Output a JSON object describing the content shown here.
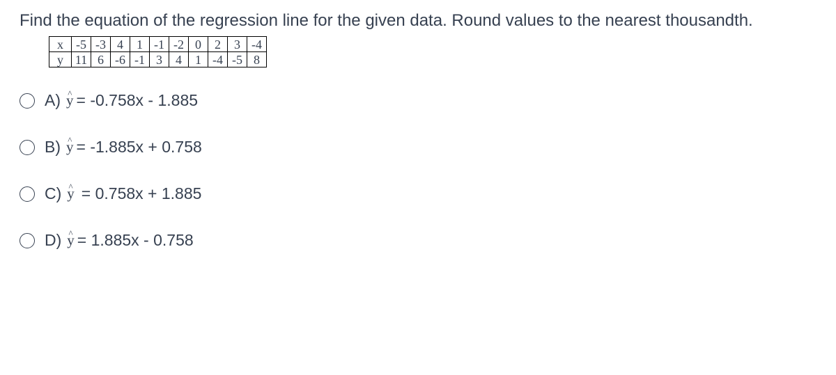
{
  "prompt": "Find the equation of the regression line for the given data. Round values to the nearest thousandth.",
  "table": {
    "xlabel": "x",
    "ylabel": "y",
    "x": [
      "-5",
      "-3",
      "4",
      "1",
      "-1",
      "-2",
      "0",
      "2",
      "3",
      "-4"
    ],
    "y": [
      "11",
      "6",
      "-6",
      "-1",
      "3",
      "4",
      "1",
      "-4",
      "-5",
      "8"
    ]
  },
  "choices": {
    "a": {
      "letter": "A)",
      "equation": "= -0.758x - 1.885"
    },
    "b": {
      "letter": "B)",
      "equation": "= -1.885x + 0.758"
    },
    "c": {
      "letter": "C)",
      "equation": "= 0.758x + 1.885"
    },
    "d": {
      "letter": "D)",
      "equation": "= 1.885x - 0.758"
    }
  },
  "chart_data": {
    "type": "table",
    "title": "Regression data table",
    "series": [
      {
        "name": "x",
        "values": [
          -5,
          -3,
          4,
          1,
          -1,
          -2,
          0,
          2,
          3,
          -4
        ]
      },
      {
        "name": "y",
        "values": [
          11,
          6,
          -6,
          -1,
          3,
          4,
          1,
          -4,
          -5,
          8
        ]
      }
    ]
  }
}
